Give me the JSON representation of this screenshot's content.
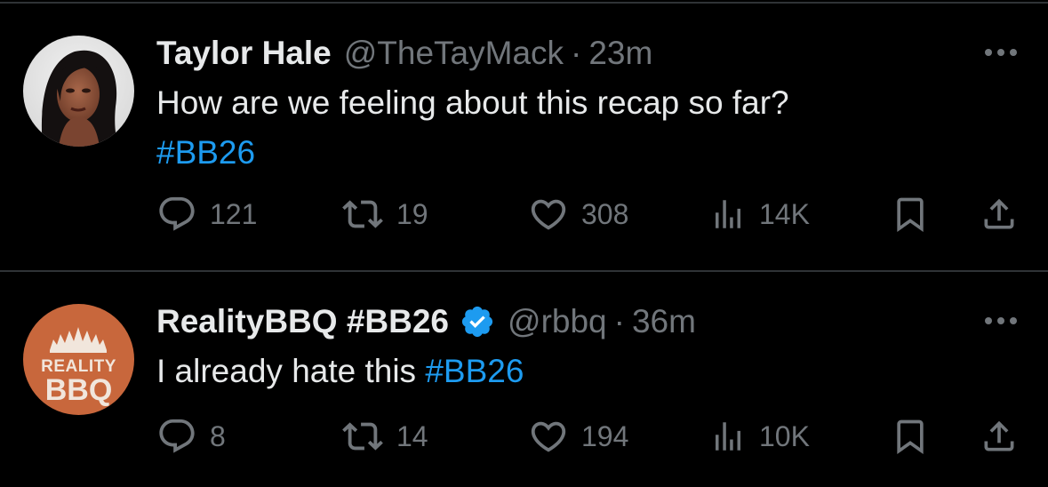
{
  "tweets": [
    {
      "name": "Taylor Hale",
      "handle": "@TheTayMack",
      "separator": "·",
      "time": "23m",
      "verified": false,
      "text_plain": "How are we feeling about this recap so far?",
      "text_hashtag": "#BB26",
      "stats": {
        "replies": "121",
        "retweets": "19",
        "likes": "308",
        "views": "14K"
      }
    },
    {
      "name": "RealityBBQ #BB26",
      "handle": "@rbbq",
      "separator": "·",
      "time": "36m",
      "verified": true,
      "text_plain": "I already hate this",
      "text_hashtag": "#BB26",
      "logo_text_top": "REALITY",
      "logo_text_bottom": "BBQ",
      "stats": {
        "replies": "8",
        "retweets": "14",
        "likes": "194",
        "views": "10K"
      }
    }
  ],
  "colors": {
    "background": "#000000",
    "text": "#e7e9ea",
    "muted": "#71767b",
    "link": "#1d9bf0",
    "divider": "#2f3336",
    "verified": "#1d9bf0",
    "bbq_logo": "#c8673c"
  },
  "icons": [
    "reply-icon",
    "retweet-icon",
    "like-icon",
    "views-icon",
    "bookmark-icon",
    "share-icon",
    "more-icon",
    "verified-badge-icon"
  ]
}
